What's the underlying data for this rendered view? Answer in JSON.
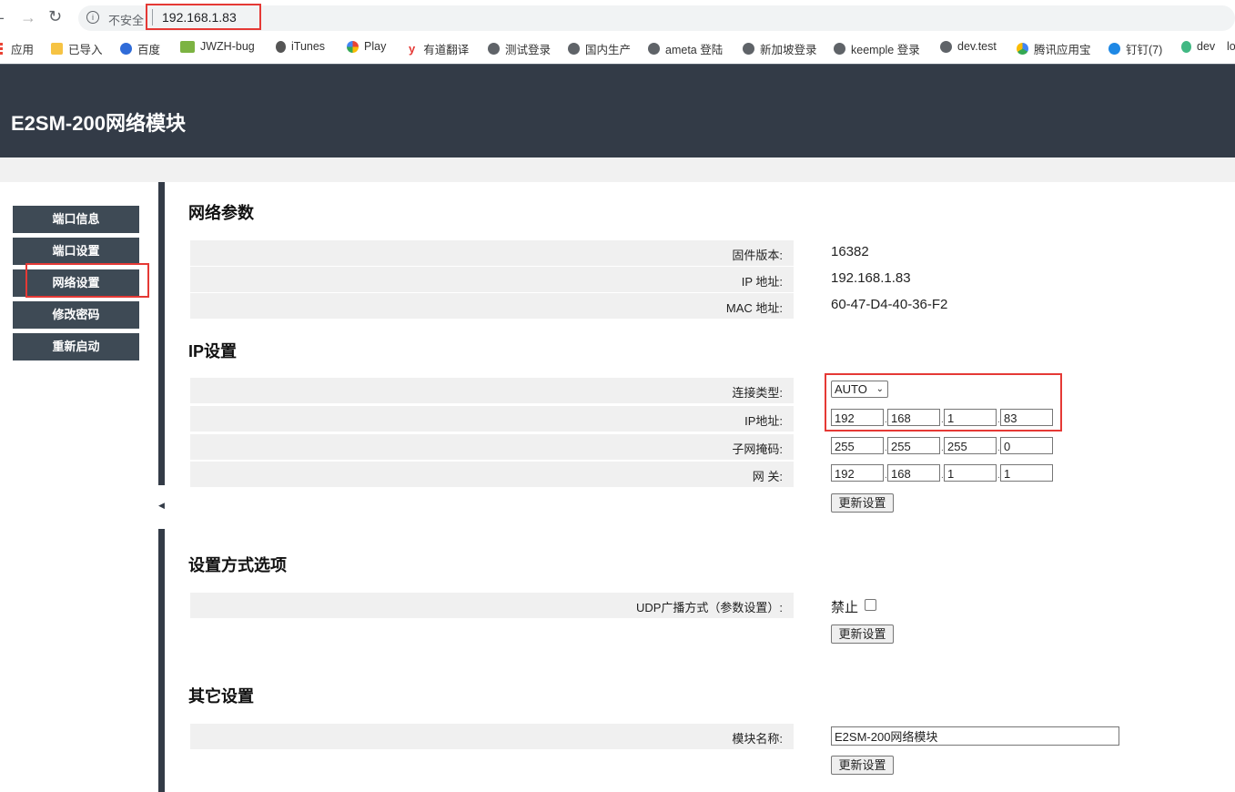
{
  "browser": {
    "security_label": "不安全",
    "url": "192.168.1.83",
    "bookmarks": [
      {
        "label": "应用",
        "icon": "apps-icon"
      },
      {
        "label": "已导入",
        "icon": "folder-icon"
      },
      {
        "label": "百度",
        "icon": "baidu-icon"
      },
      {
        "label": "JWZH-bug",
        "icon": "bug-icon"
      },
      {
        "label": "iTunes",
        "icon": "apple-icon"
      },
      {
        "label": "Play",
        "icon": "google-icon"
      },
      {
        "label": "有道翻译",
        "icon": "youdao-icon"
      },
      {
        "label": "测试登录",
        "icon": "globe-icon"
      },
      {
        "label": "国内生产",
        "icon": "globe-icon"
      },
      {
        "label": "ameta 登陆",
        "icon": "globe-icon"
      },
      {
        "label": "新加坡登录",
        "icon": "globe-icon"
      },
      {
        "label": "keemple 登录",
        "icon": "globe-icon"
      },
      {
        "label": "dev.test",
        "icon": "globe-icon"
      },
      {
        "label": "腾讯应用宝",
        "icon": "tencent-icon"
      },
      {
        "label": "钉钉(7)",
        "icon": "dingtalk-icon"
      },
      {
        "label": "dev",
        "icon": "vue-icon"
      },
      {
        "label": "lo",
        "icon": ""
      }
    ]
  },
  "header": {
    "title": "E2SM-200网络模块"
  },
  "sidebar": {
    "items": [
      {
        "label": "端口信息"
      },
      {
        "label": "端口设置"
      },
      {
        "label": "网络设置"
      },
      {
        "label": "修改密码"
      },
      {
        "label": "重新启动"
      }
    ]
  },
  "network_params": {
    "title": "网络参数",
    "rows": [
      {
        "label": "固件版本:",
        "value": "16382"
      },
      {
        "label": "IP 地址:",
        "value": "192.168.1.83"
      },
      {
        "label": "MAC 地址:",
        "value": "60-47-D4-40-36-F2"
      }
    ]
  },
  "ip_settings": {
    "title": "IP设置",
    "conn_type_label": "连接类型:",
    "conn_type_value": "AUTO",
    "ip_label": "IP地址:",
    "ip": [
      "192",
      "168",
      "1",
      "83"
    ],
    "mask_label": "子网掩码:",
    "mask": [
      "255",
      "255",
      "255",
      "0"
    ],
    "gateway_label": "网 关:",
    "gateway": [
      "192",
      "168",
      "1",
      "1"
    ],
    "update_button": "更新设置"
  },
  "setup_options": {
    "title": "设置方式选项",
    "udp_label": "UDP广播方式（参数设置）:",
    "udp_value": "禁止",
    "update_button": "更新设置"
  },
  "other_settings": {
    "title": "其它设置",
    "module_name_label": "模块名称:",
    "module_name_value": "E2SM-200网络模块",
    "update_button": "更新设置"
  }
}
